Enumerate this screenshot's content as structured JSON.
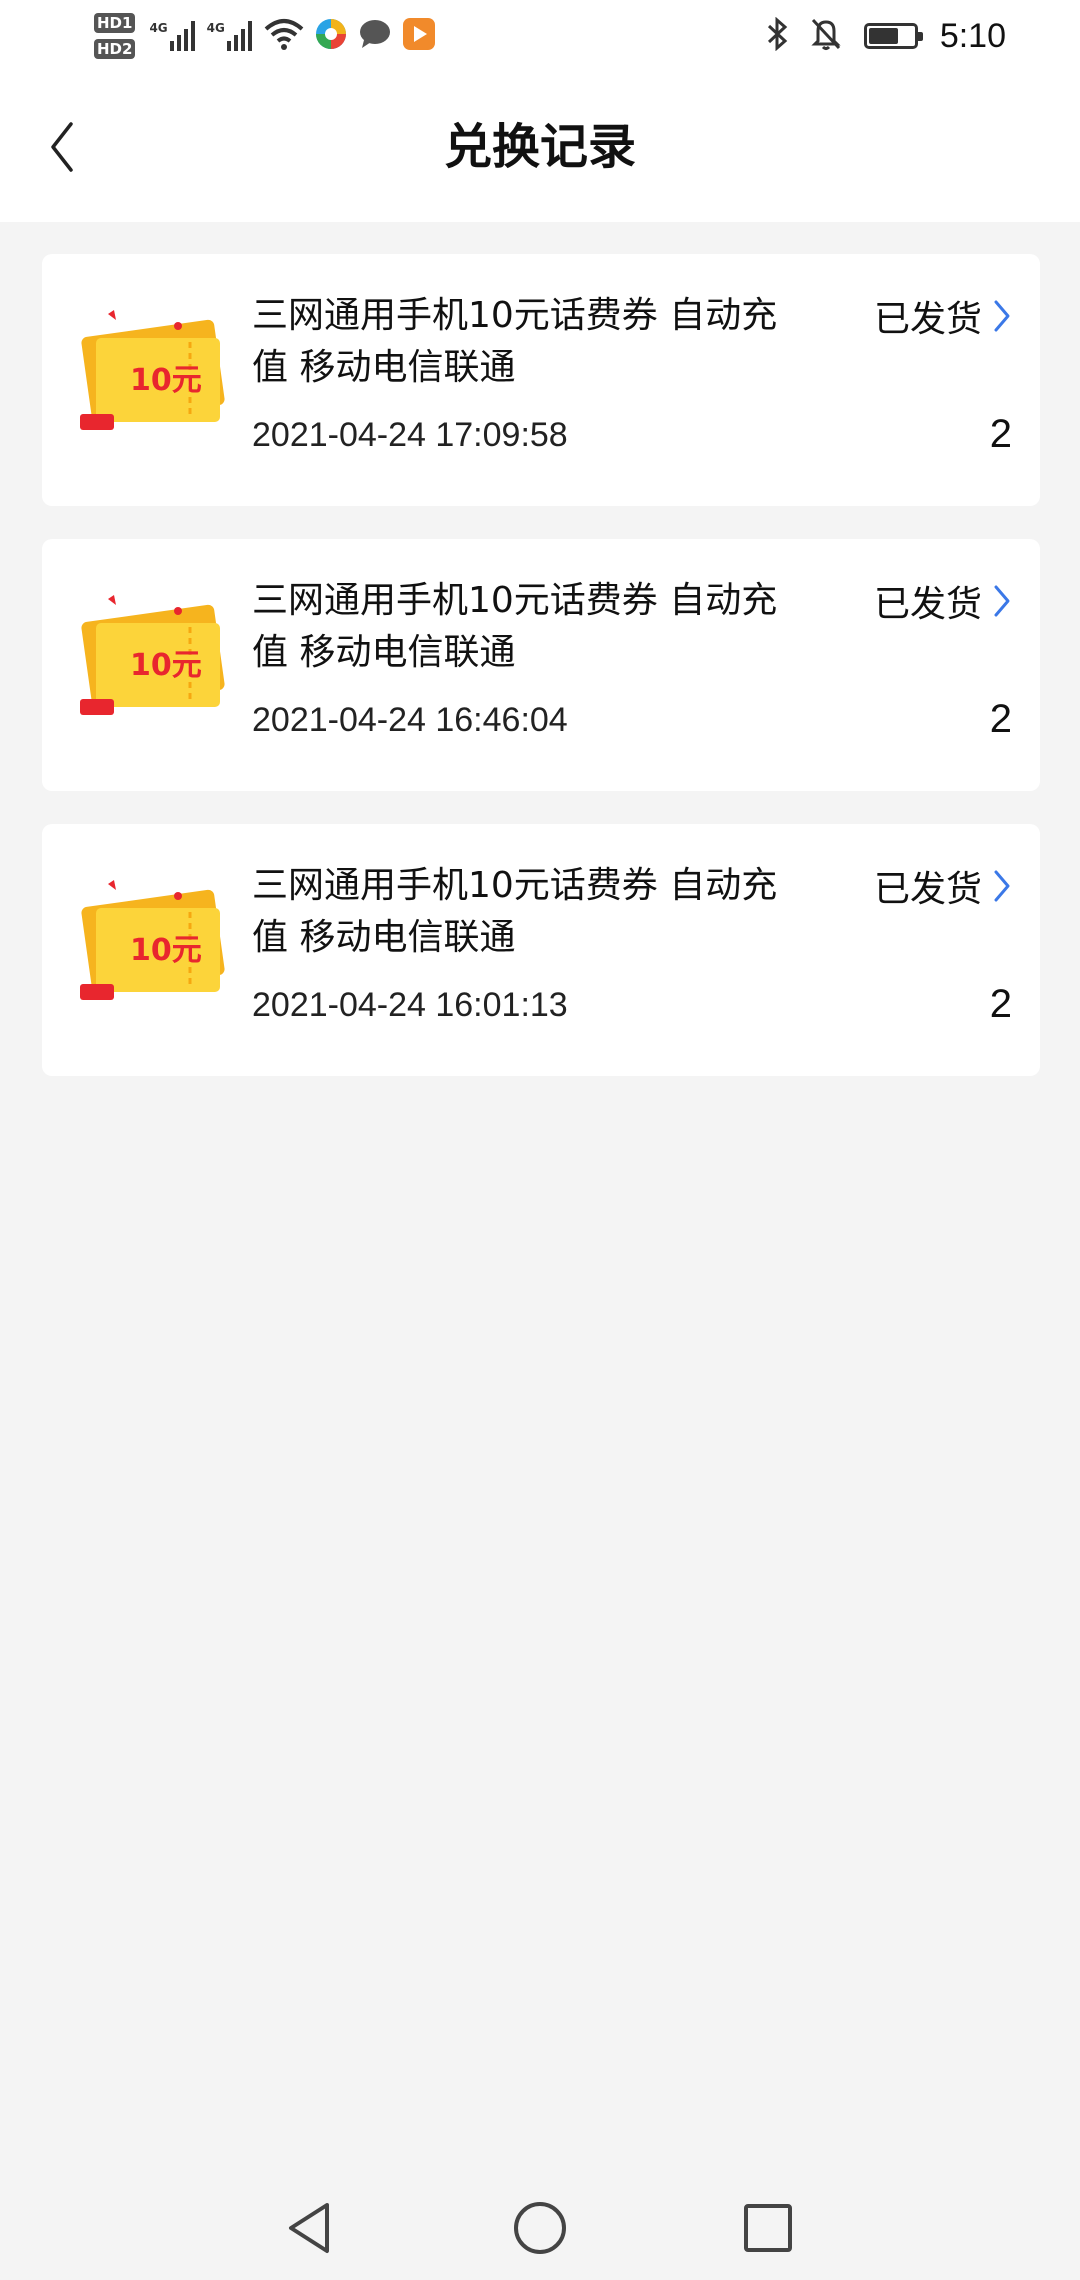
{
  "status_bar": {
    "hd1": "HD1",
    "hd2": "HD2",
    "sig1": "4G",
    "sig2": "4G",
    "time": "5:10",
    "battery_level": 0.6
  },
  "header": {
    "title": "兑换记录"
  },
  "records": [
    {
      "title": "三网通用手机10元话费券 自动充值 移动电信联通",
      "time": "2021-04-24 17:09:58",
      "status": "已发货",
      "quantity": "2",
      "coupon_label": "10元"
    },
    {
      "title": "三网通用手机10元话费券 自动充值 移动电信联通",
      "time": "2021-04-24 16:46:04",
      "status": "已发货",
      "quantity": "2",
      "coupon_label": "10元"
    },
    {
      "title": "三网通用手机10元话费券 自动充值 移动电信联通",
      "time": "2021-04-24 16:01:13",
      "status": "已发货",
      "quantity": "2",
      "coupon_label": "10元"
    }
  ],
  "colors": {
    "chevron": "#3b78e7",
    "coupon_yellow": "#f9c21f",
    "coupon_red": "#e8262e"
  }
}
